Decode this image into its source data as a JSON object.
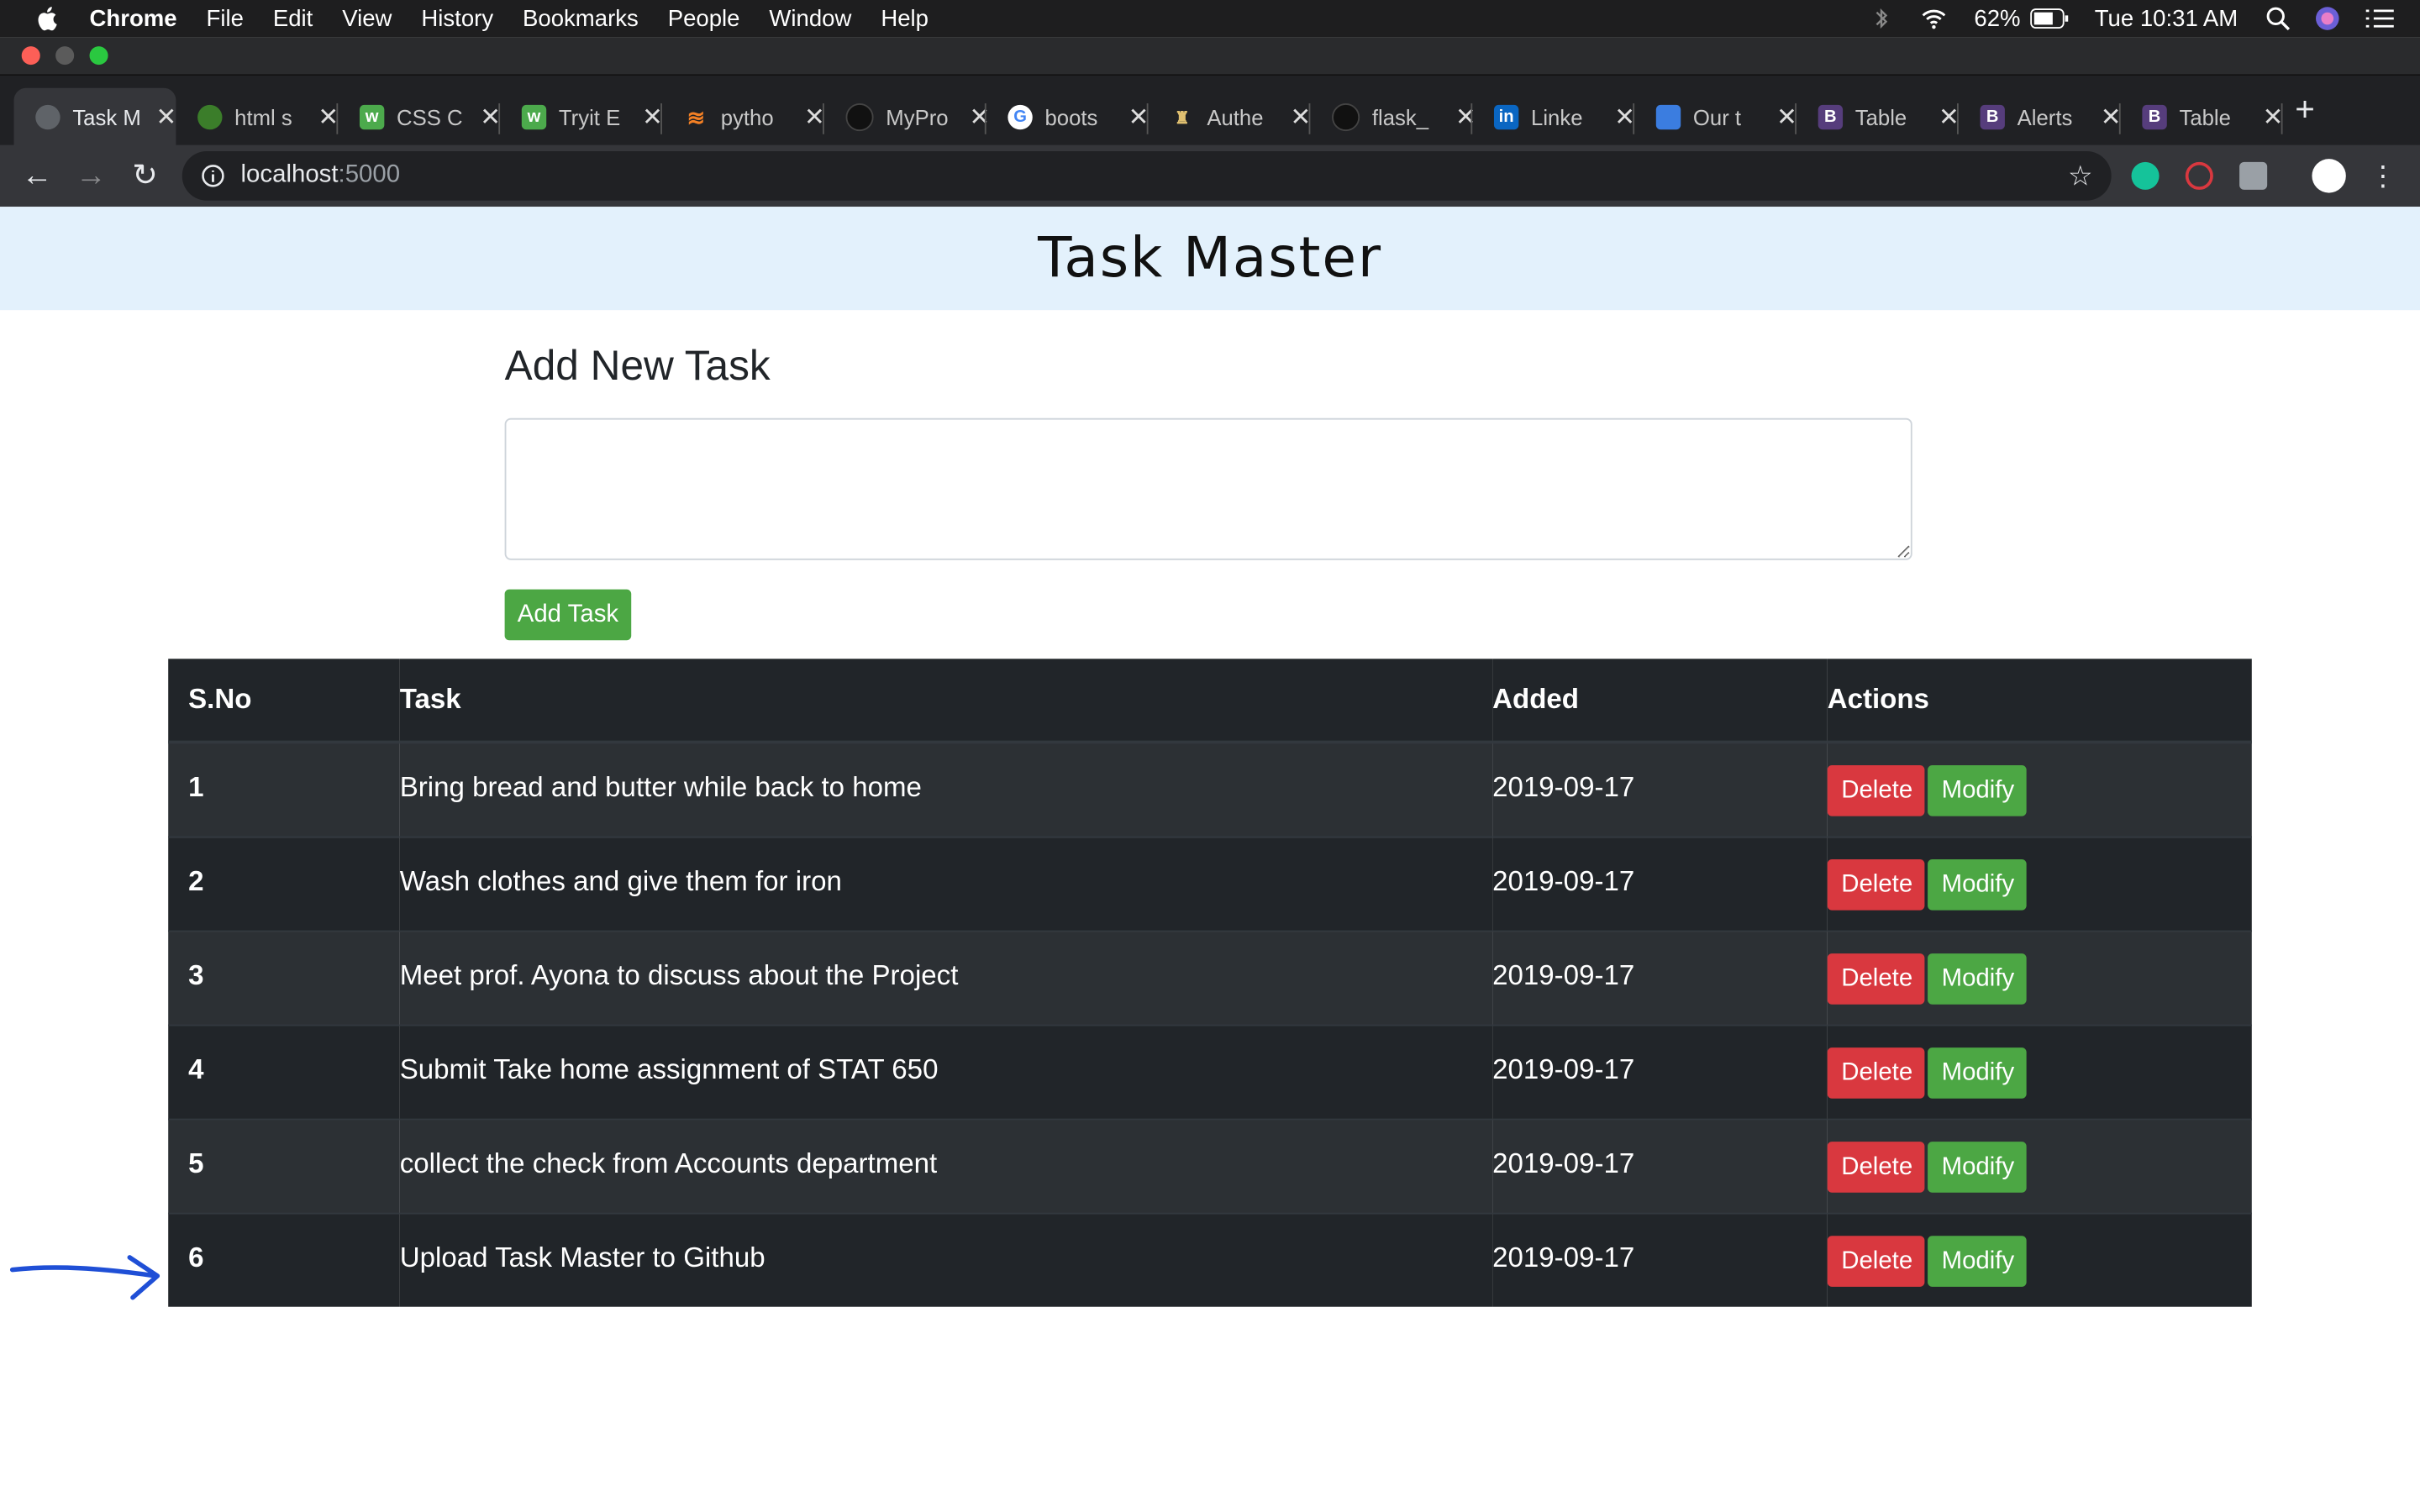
{
  "menubar": {
    "app": "Chrome",
    "items": [
      "File",
      "Edit",
      "View",
      "History",
      "Bookmarks",
      "People",
      "Window",
      "Help"
    ],
    "battery": "62%",
    "clock": "Tue 10:31 AM"
  },
  "tabs": [
    {
      "label": "Task M",
      "icon": "globe-icon",
      "active": true
    },
    {
      "label": "html s",
      "icon": "frog-icon"
    },
    {
      "label": "CSS C",
      "icon": "w3schools-icon"
    },
    {
      "label": "Tryit E",
      "icon": "w3schools-icon"
    },
    {
      "label": "pytho",
      "icon": "stackoverflow-icon"
    },
    {
      "label": "MyPro",
      "icon": "github-icon"
    },
    {
      "label": "boots",
      "icon": "google-icon"
    },
    {
      "label": "Authe",
      "icon": "flask-icon"
    },
    {
      "label": "flask_",
      "icon": "github-icon"
    },
    {
      "label": "Linke",
      "icon": "linkedin-icon"
    },
    {
      "label": "Our t",
      "icon": "doc-icon"
    },
    {
      "label": "Table",
      "icon": "bootstrap-icon"
    },
    {
      "label": "Alerts",
      "icon": "bootstrap-icon"
    },
    {
      "label": "Table",
      "icon": "bootstrap-icon"
    }
  ],
  "address": {
    "host": "localhost",
    "port": ":5000"
  },
  "page": {
    "title": "Task Master",
    "form_title": "Add New Task",
    "input_value": "",
    "add_button": "Add Task"
  },
  "table": {
    "headers": [
      "S.No",
      "Task",
      "Added",
      "Actions"
    ],
    "delete_label": "Delete",
    "modify_label": "Modify",
    "rows": [
      {
        "sno": "1",
        "task": "Bring bread and butter while back to home",
        "added": "2019-09-17"
      },
      {
        "sno": "2",
        "task": "Wash clothes and give them for iron",
        "added": "2019-09-17"
      },
      {
        "sno": "3",
        "task": "Meet prof. Ayona to discuss about the Project",
        "added": "2019-09-17"
      },
      {
        "sno": "4",
        "task": "Submit Take home assignment of STAT 650",
        "added": "2019-09-17"
      },
      {
        "sno": "5",
        "task": "collect the check from Accounts department",
        "added": "2019-09-17"
      },
      {
        "sno": "6",
        "task": "Upload Task Master to Github",
        "added": "2019-09-17"
      }
    ]
  },
  "colors": {
    "header_bg": "#e3f1fc",
    "table_dark": "#212529",
    "table_stripe": "#2c3034",
    "success": "#4ca744",
    "danger": "#d9383f",
    "annotation_arrow": "#1f4fd6"
  },
  "icons": [
    "apple-icon",
    "bluetooth-icon",
    "wifi-icon",
    "battery-icon",
    "spotlight-icon",
    "siri-icon",
    "control-center-icon",
    "back-icon",
    "forward-icon",
    "reload-icon",
    "info-icon",
    "star-icon",
    "grammarly-icon",
    "extension-icon",
    "profile-icon",
    "more-icon",
    "arrow-annotation"
  ]
}
